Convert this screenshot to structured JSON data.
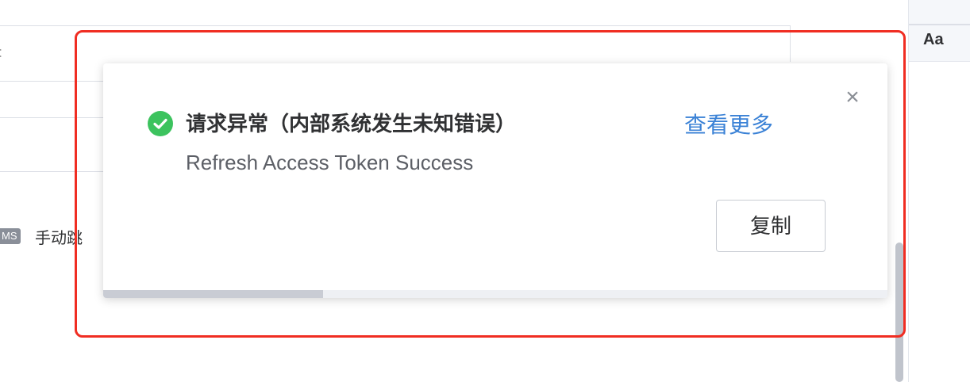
{
  "background": {
    "tag": "MS",
    "link_text": "手动跳",
    "right_panel_label": "Aa"
  },
  "notification": {
    "icon": "check-circle-icon",
    "title": "请求异常（内部系统发生未知错误）",
    "more_link": "查看更多",
    "message": "Refresh Access Token Success",
    "copy_button": "复制",
    "close_icon": "×",
    "progress": 0.28,
    "colors": {
      "success": "#3cc35e",
      "link": "#3b82d6",
      "highlight_border": "#f02d22"
    }
  }
}
